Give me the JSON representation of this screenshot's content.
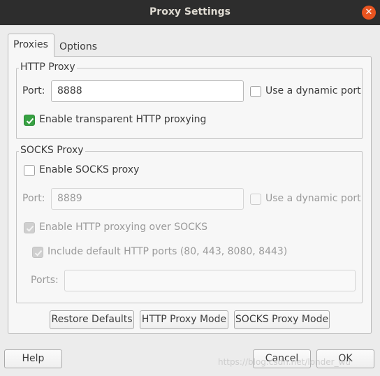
{
  "window": {
    "title": "Proxy Settings"
  },
  "tabs": [
    {
      "label": "Proxies",
      "active": true
    },
    {
      "label": "Options",
      "active": false
    }
  ],
  "http_proxy": {
    "group_title": "HTTP Proxy",
    "port_label": "Port:",
    "port_value": "8888",
    "dynamic_port_label": "Use a dynamic port",
    "dynamic_port_checked": false,
    "transparent_label": "Enable transparent HTTP proxying",
    "transparent_checked": true
  },
  "socks_proxy": {
    "group_title": "SOCKS Proxy",
    "enable_label": "Enable SOCKS proxy",
    "enable_checked": false,
    "port_label": "Port:",
    "port_value": "8889",
    "dynamic_port_label": "Use a dynamic port",
    "http_over_socks_label": "Enable HTTP proxying over SOCKS",
    "http_over_socks_checked": true,
    "default_ports_label": "Include default HTTP ports (80, 443, 8080, 8443)",
    "default_ports_checked": true,
    "ports_label": "Ports:",
    "ports_value": ""
  },
  "mode_buttons": {
    "restore": "Restore Defaults",
    "http_mode": "HTTP Proxy Mode",
    "socks_mode": "SOCKS Proxy Mode"
  },
  "dialog_buttons": {
    "help": "Help",
    "cancel": "Cancel",
    "ok": "OK"
  },
  "watermark": "https://blog.csdn.net/londer_wu",
  "colors": {
    "accent_checked": "#37a142",
    "close_button": "#e95420",
    "titlebar": "#2d2d2d"
  }
}
